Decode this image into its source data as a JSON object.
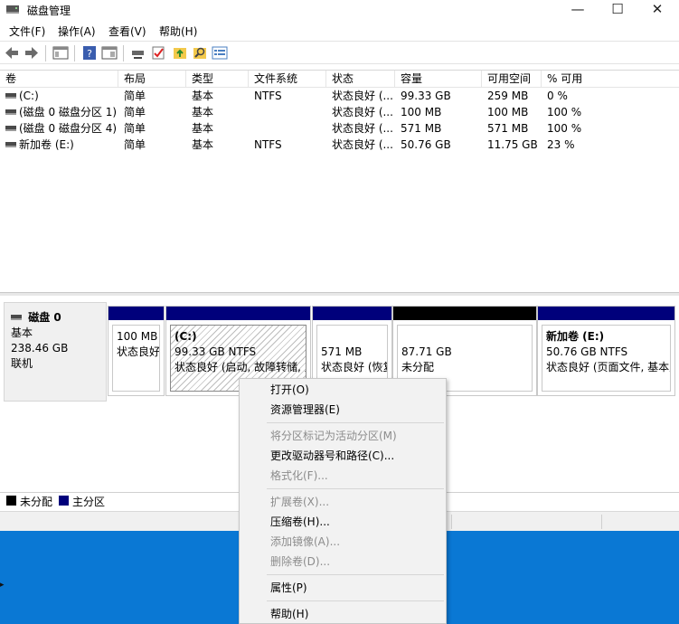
{
  "window": {
    "title": "磁盘管理"
  },
  "titlebar": {
    "minimize": "—",
    "maximize": "☐",
    "close": "✕"
  },
  "menu": [
    "文件(F)",
    "操作(A)",
    "查看(V)",
    "帮助(H)"
  ],
  "toolbar": {
    "icons": [
      "back-icon",
      "forward-icon",
      "console-tree-icon",
      "help-icon",
      "show-pane-icon",
      "connect-icon",
      "check-icon",
      "open-folder-icon",
      "search-icon",
      "properties-icon"
    ]
  },
  "volume_list": {
    "columns": [
      "卷",
      "布局",
      "类型",
      "文件系统",
      "状态",
      "容量",
      "可用空间",
      "% 可用"
    ],
    "rows": [
      [
        "(C:)",
        "简单",
        "基本",
        "NTFS",
        "状态良好 (...",
        "99.33 GB",
        "259 MB",
        "0 %"
      ],
      [
        "(磁盘 0 磁盘分区 1)",
        "简单",
        "基本",
        "",
        "状态良好 (...",
        "100 MB",
        "100 MB",
        "100 %"
      ],
      [
        "(磁盘 0 磁盘分区 4)",
        "简单",
        "基本",
        "",
        "状态良好 (...",
        "571 MB",
        "571 MB",
        "100 %"
      ],
      [
        "新加卷 (E:)",
        "简单",
        "基本",
        "NTFS",
        "状态良好 (...",
        "50.76 GB",
        "11.75 GB",
        "23 %"
      ]
    ]
  },
  "disk": {
    "name": "磁盘 0",
    "type": "基本",
    "size": "238.46 GB",
    "status": "联机",
    "partitions": [
      {
        "title": "",
        "line1": "100 MB",
        "line2": "状态良好",
        "bar": "#00007b"
      },
      {
        "title": "(C:)",
        "line1": "99.33 GB NTFS",
        "line2": "状态良好 (启动, 故障转储, 主",
        "bar": "#00007b"
      },
      {
        "title": "",
        "line1": "571 MB",
        "line2": "状态良好 (恢复",
        "bar": "#00007b"
      },
      {
        "title": "",
        "line1": "87.71 GB",
        "line2": "未分配",
        "bar": "#000000"
      },
      {
        "title": "新加卷  (E:)",
        "line1": "50.76 GB NTFS",
        "line2": "状态良好 (页面文件, 基本主",
        "bar": "#00007b"
      }
    ]
  },
  "legend": [
    {
      "label": "未分配",
      "color": "#000000"
    },
    {
      "label": "主分区",
      "color": "#00007b"
    }
  ],
  "context_menu": {
    "items": [
      {
        "label": "打开(O)",
        "enabled": true
      },
      {
        "label": "资源管理器(E)",
        "enabled": true
      },
      {
        "label": "将分区标记为活动分区(M)",
        "enabled": false
      },
      {
        "label": "更改驱动器号和路径(C)...",
        "enabled": true
      },
      {
        "label": "格式化(F)...",
        "enabled": false
      },
      {
        "label": "扩展卷(X)...",
        "enabled": false
      },
      {
        "label": "压缩卷(H)...",
        "enabled": true
      },
      {
        "label": "添加镜像(A)...",
        "enabled": false
      },
      {
        "label": "删除卷(D)...",
        "enabled": false
      },
      {
        "label": "属性(P)",
        "enabled": true
      },
      {
        "label": "帮助(H)",
        "enabled": true
      }
    ]
  }
}
